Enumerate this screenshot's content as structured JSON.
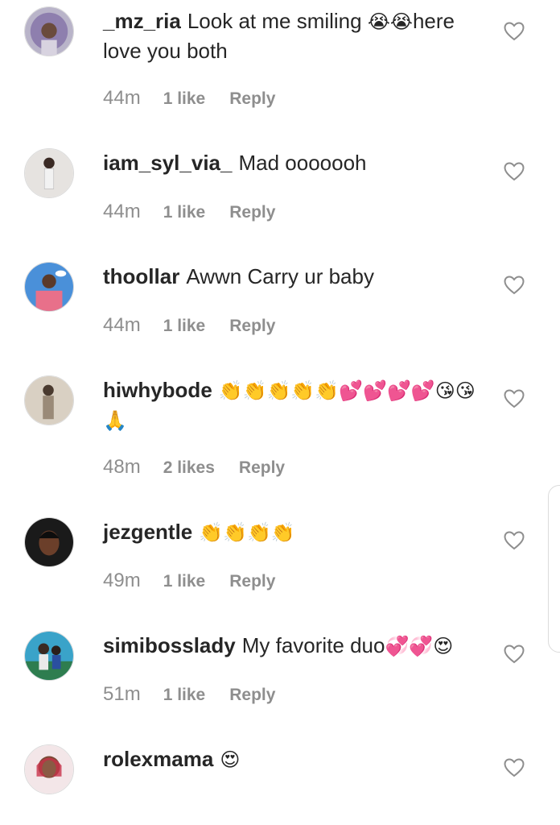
{
  "comments": [
    {
      "username": "_mz_ria",
      "text": "Look at me smiling",
      "emoji_after": "😭😭",
      "text2": "here love you both",
      "time": "44m",
      "likes": "1 like",
      "reply": "Reply"
    },
    {
      "username": "iam_syl_via_",
      "text": "Mad ooooooh",
      "time": "44m",
      "likes": "1 like",
      "reply": "Reply"
    },
    {
      "username": "thoollar",
      "text": "Awwn Carry ur baby",
      "time": "44m",
      "likes": "1 like",
      "reply": "Reply"
    },
    {
      "username": "hiwhybode",
      "emoji": "👏👏👏👏👏💕💕💕💕😘😘🙏",
      "time": "48m",
      "likes": "2 likes",
      "reply": "Reply"
    },
    {
      "username": "jezgentle",
      "emoji": "👏👏👏👏",
      "time": "49m",
      "likes": "1 like",
      "reply": "Reply"
    },
    {
      "username": "simibosslady",
      "text": "My favorite duo",
      "emoji_after": "💞💞😍",
      "time": "51m",
      "likes": "1 like",
      "reply": "Reply"
    },
    {
      "username": "rolexmama",
      "emoji": "😍"
    }
  ],
  "icons": {
    "like": "heart-outline-icon"
  },
  "colors": {
    "text": "#262626",
    "meta": "#8e8e8e",
    "heart": "#8e8e8e"
  }
}
